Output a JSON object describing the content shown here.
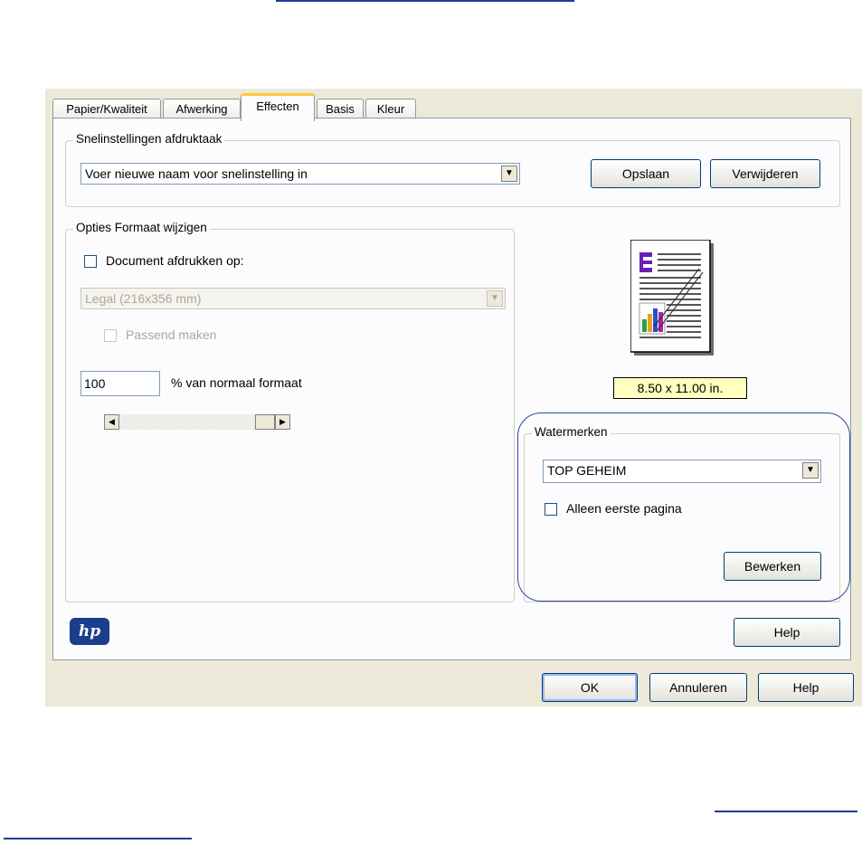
{
  "tabs": [
    "Papier/Kwaliteit",
    "Afwerking",
    "Effecten",
    "Basis",
    "Kleur"
  ],
  "quick_settings": {
    "title": "Snelinstellingen afdruktaak",
    "selected": "Voer nieuwe naam voor snelinstelling in",
    "save_label": "Opslaan",
    "delete_label": "Verwijderen"
  },
  "resize": {
    "title": "Opties Formaat wijzigen",
    "print_on_label": "Document afdrukken op:",
    "paper_selected": "Legal (216x356 mm)",
    "fit_label": "Passend maken",
    "percent_value": "100",
    "percent_label": "% van normaal formaat"
  },
  "preview": {
    "size_label": "8.50 x 11.00 in."
  },
  "watermarks": {
    "title": "Watermerken",
    "selected": "TOP GEHEIM",
    "first_page_label": "Alleen eerste pagina",
    "edit_label": "Bewerken"
  },
  "help_label": "Help",
  "footer": {
    "ok_label": "OK",
    "cancel_label": "Annuleren",
    "help_label": "Help"
  },
  "icons": {
    "logo": "hp-logo",
    "preview": "document-preview-icon",
    "dropdown": "chevron-down-icon"
  },
  "colors": {
    "dialog_bg": "#ece9d8",
    "page_bg": "#fcfcfe",
    "active_tab_accent": "#ffc83c",
    "highlight_border": "#2b4a9a",
    "size_label_bg": "#ffffc0"
  }
}
